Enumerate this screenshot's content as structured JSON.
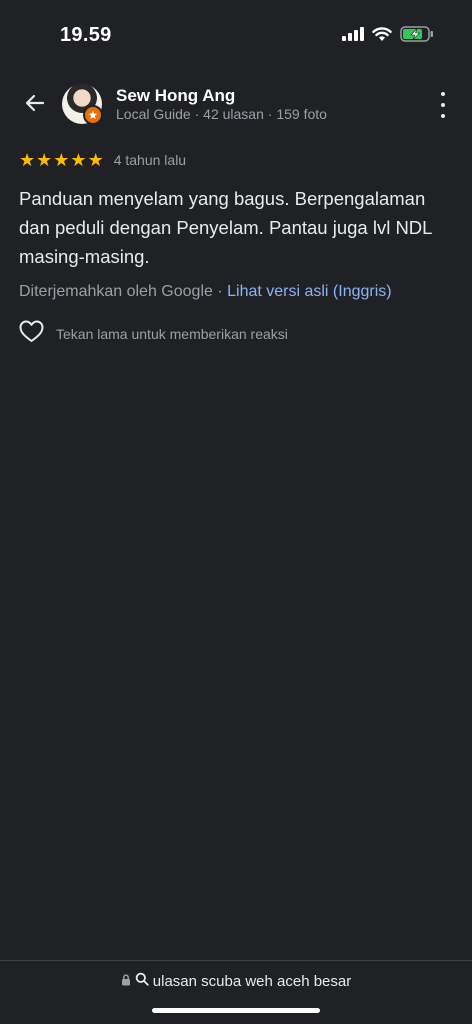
{
  "status_bar": {
    "time": "19.59",
    "icons": [
      "cellular-signal-icon",
      "wifi-icon",
      "battery-charging-icon"
    ]
  },
  "header": {
    "back_icon": "arrow-left-icon",
    "reviewer_name": "Sew Hong Ang",
    "reviewer_meta": "Local Guide · 42 ulasan · 159 foto",
    "more_icon": "more-vertical-icon",
    "badge_icon": "local-guide-badge-icon"
  },
  "review": {
    "stars": 5,
    "star_symbols": [
      "★",
      "★",
      "★",
      "★",
      "★"
    ],
    "time_ago": "4 tahun lalu",
    "text": "Panduan menyelam yang bagus. Berpengalaman dan peduli dengan Penyelam. Pantau juga lvl NDL masing-masing.",
    "translated_by": "Diterjemahkan oleh Google · ",
    "see_original": "Lihat versi asli (Inggris)",
    "reaction_hint": "Tekan lama untuk memberikan reaksi"
  },
  "browser_bar": {
    "url_text": "ulasan scuba weh aceh besar",
    "icons": [
      "lock-icon",
      "search-icon"
    ]
  },
  "colors": {
    "background": "#202124",
    "star": "#fbbc04",
    "link": "#8ab4f8",
    "secondary_text": "#9aa0a6"
  }
}
